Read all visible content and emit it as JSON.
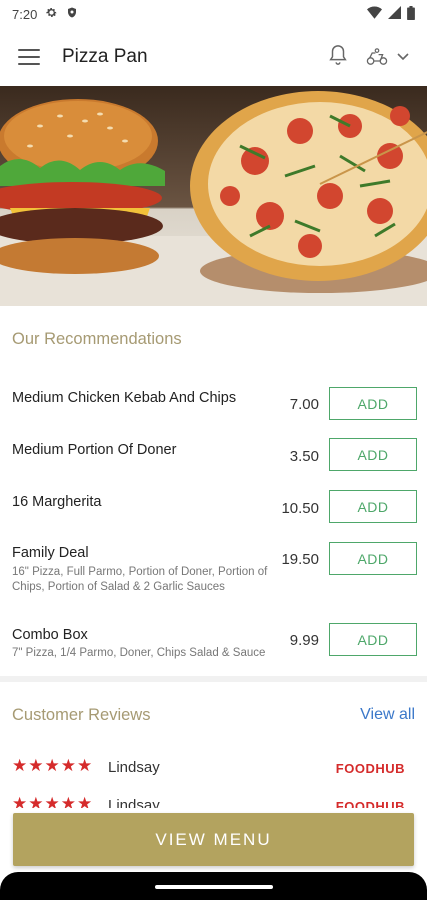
{
  "status_bar": {
    "time": "7:20"
  },
  "app_bar": {
    "title": "Pizza Pan"
  },
  "recommendations": {
    "title": "Our Recommendations",
    "items": [
      {
        "name": "Medium Chicken Kebab And Chips",
        "desc": "",
        "price": "7.00",
        "button": "ADD"
      },
      {
        "name": "Medium Portion Of Doner",
        "desc": "",
        "price": "3.50",
        "button": "ADD"
      },
      {
        "name": "16 Margherita",
        "desc": "",
        "price": "10.50",
        "button": "ADD"
      },
      {
        "name": "Family Deal",
        "desc": "16\" Pizza, Full Parmo, Portion of Doner, Portion of Chips, Portion of Salad & 2 Garlic Sauces",
        "price": "19.50",
        "button": "ADD"
      },
      {
        "name": "Combo Box",
        "desc": "7\" Pizza, 1/4 Parmo, Doner, Chips Salad & Sauce",
        "price": "9.99",
        "button": "ADD"
      }
    ]
  },
  "reviews": {
    "title": "Customer Reviews",
    "view_all": "View all",
    "items": [
      {
        "stars": "★★★★★",
        "name": "Lindsay",
        "source": "FOODHUB"
      },
      {
        "stars": "★★★★★",
        "name": "Lindsay",
        "source": "FOODHUB"
      }
    ]
  },
  "cta": {
    "label": "VIEW MENU"
  },
  "colors": {
    "accent": "#b3a35f",
    "add_green": "#4ea76a",
    "star_red": "#d52b2b",
    "link_blue": "#3b78c9"
  }
}
